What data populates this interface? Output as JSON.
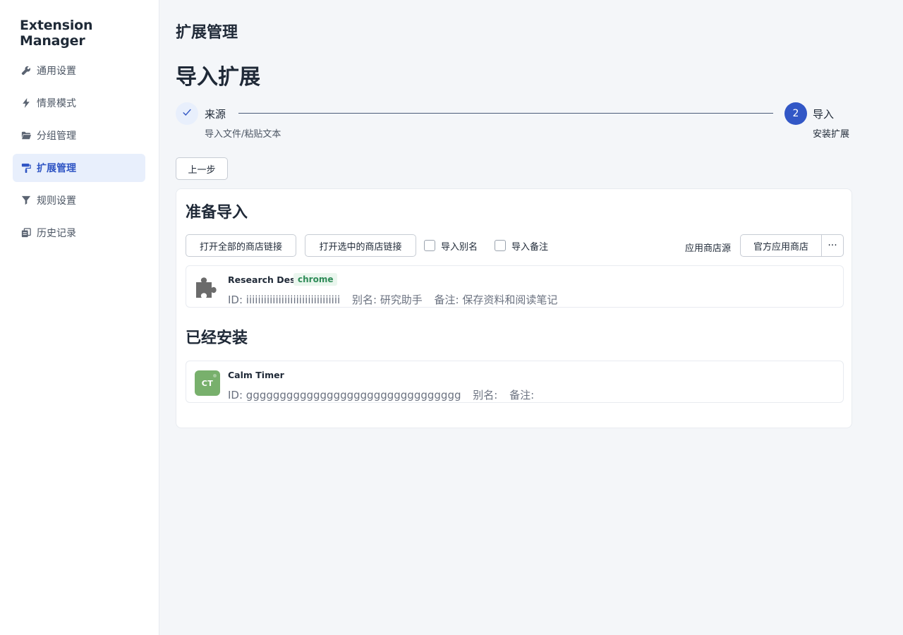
{
  "app": {
    "title": "Extension Manager"
  },
  "sidebar": {
    "items": [
      {
        "label": "通用设置",
        "icon": "wrench-icon",
        "active": false
      },
      {
        "label": "情景模式",
        "icon": "bolt-icon",
        "active": false
      },
      {
        "label": "分组管理",
        "icon": "folder-icon",
        "active": false
      },
      {
        "label": "扩展管理",
        "icon": "paint-roller-icon",
        "active": true
      },
      {
        "label": "规则设置",
        "icon": "filter-icon",
        "active": false
      },
      {
        "label": "历史记录",
        "icon": "history-icon",
        "active": false
      }
    ]
  },
  "header": {
    "title": "扩展管理"
  },
  "main": {
    "section_title": "导入扩展",
    "steps": [
      {
        "title": "来源",
        "description": "导入文件/粘贴文本",
        "status": "done",
        "icon": "check-icon"
      },
      {
        "title": "导入",
        "description": "安装扩展",
        "status": "current",
        "number": "2"
      }
    ],
    "prev_button": "上一步"
  },
  "prepare": {
    "title": "准备导入",
    "open_all_button": "打开全部的商店链接",
    "open_selected_button": "打开选中的商店链接",
    "import_alias_label": "导入别名",
    "import_alias_checked": false,
    "import_remark_label": "导入备注",
    "import_remark_checked": false,
    "store_source_label": "应用商店源",
    "store_source_value": "官方应用商店",
    "more_button": "···",
    "items": [
      {
        "name": "Research Desk",
        "badge": "chrome",
        "icon": "puzzle-icon",
        "id_text": "ID: iiiiiiiiiiiiiiiiiiiiiiiiiiiiiiii",
        "alias_text": "别名: 研究助手",
        "remark_text": "备注: 保存资料和阅读笔记"
      }
    ]
  },
  "installed": {
    "title": "已经安装",
    "items": [
      {
        "name": "Calm Timer",
        "icon_text": "CT",
        "icon_color": "#78b06c",
        "id_text": "ID: gggggggggggggggggggggggggggggggg",
        "alias_text": "别名:",
        "remark_text": "备注:"
      }
    ]
  },
  "colors": {
    "accent": "#3257c6",
    "active_bg": "#e8effc",
    "badge_green": "#2e8b57"
  }
}
